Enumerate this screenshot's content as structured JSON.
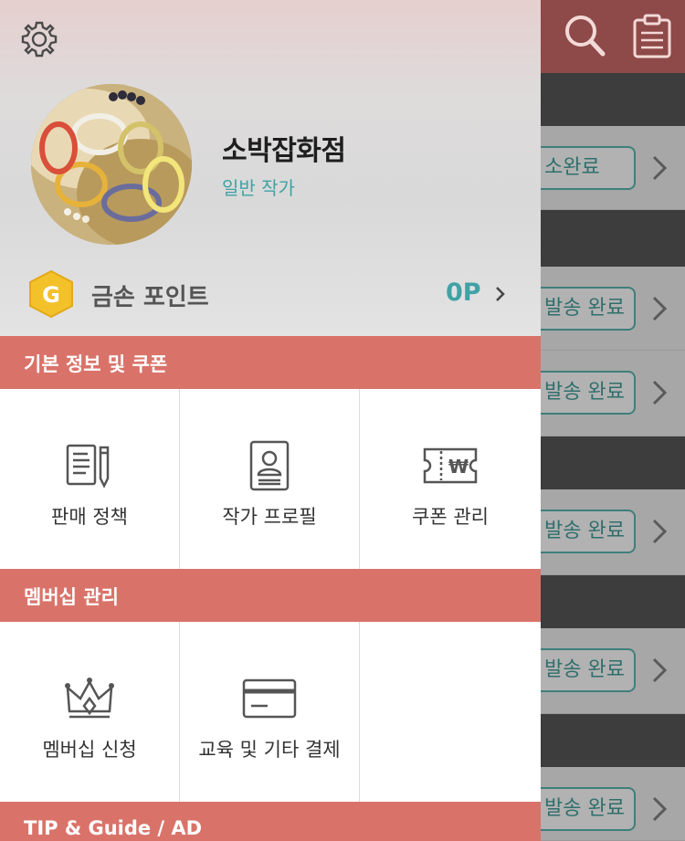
{
  "background_app": {
    "header_icons": [
      "search-icon",
      "clipboard-icon"
    ],
    "rows": [
      {
        "button_label": "소완료"
      },
      {
        "button_label": "발송 완료"
      },
      {
        "button_label": "발송 완료"
      },
      {
        "button_label": "발송 완료"
      },
      {
        "button_label": "발송 완료"
      },
      {
        "button_label": "발송 완료"
      }
    ]
  },
  "drawer": {
    "settings_icon": "gear-icon",
    "profile": {
      "shop_name": "소박잡화점",
      "grade": "일반 작가"
    },
    "points": {
      "label": "금손 포인트",
      "value": "0P",
      "coin_letter": "G"
    },
    "sections": [
      {
        "title": "기본 정보 및 쿠폰",
        "items": [
          {
            "label": "판매 정책",
            "icon": "sales-policy-icon"
          },
          {
            "label": "작가 프로필",
            "icon": "artist-profile-icon"
          },
          {
            "label": "쿠폰 관리",
            "icon": "coupon-icon"
          }
        ]
      },
      {
        "title": "멤버십 관리",
        "items": [
          {
            "label": "멤버십 신청",
            "icon": "crown-icon"
          },
          {
            "label": "교육 및 기타 결제",
            "icon": "credit-card-icon"
          }
        ]
      },
      {
        "title": "TIP & Guide / AD",
        "items": []
      }
    ]
  },
  "colors": {
    "section_bar": "#d9736a",
    "accent_teal": "#3fa2a5",
    "coin_yellow": "#f3c12a"
  }
}
